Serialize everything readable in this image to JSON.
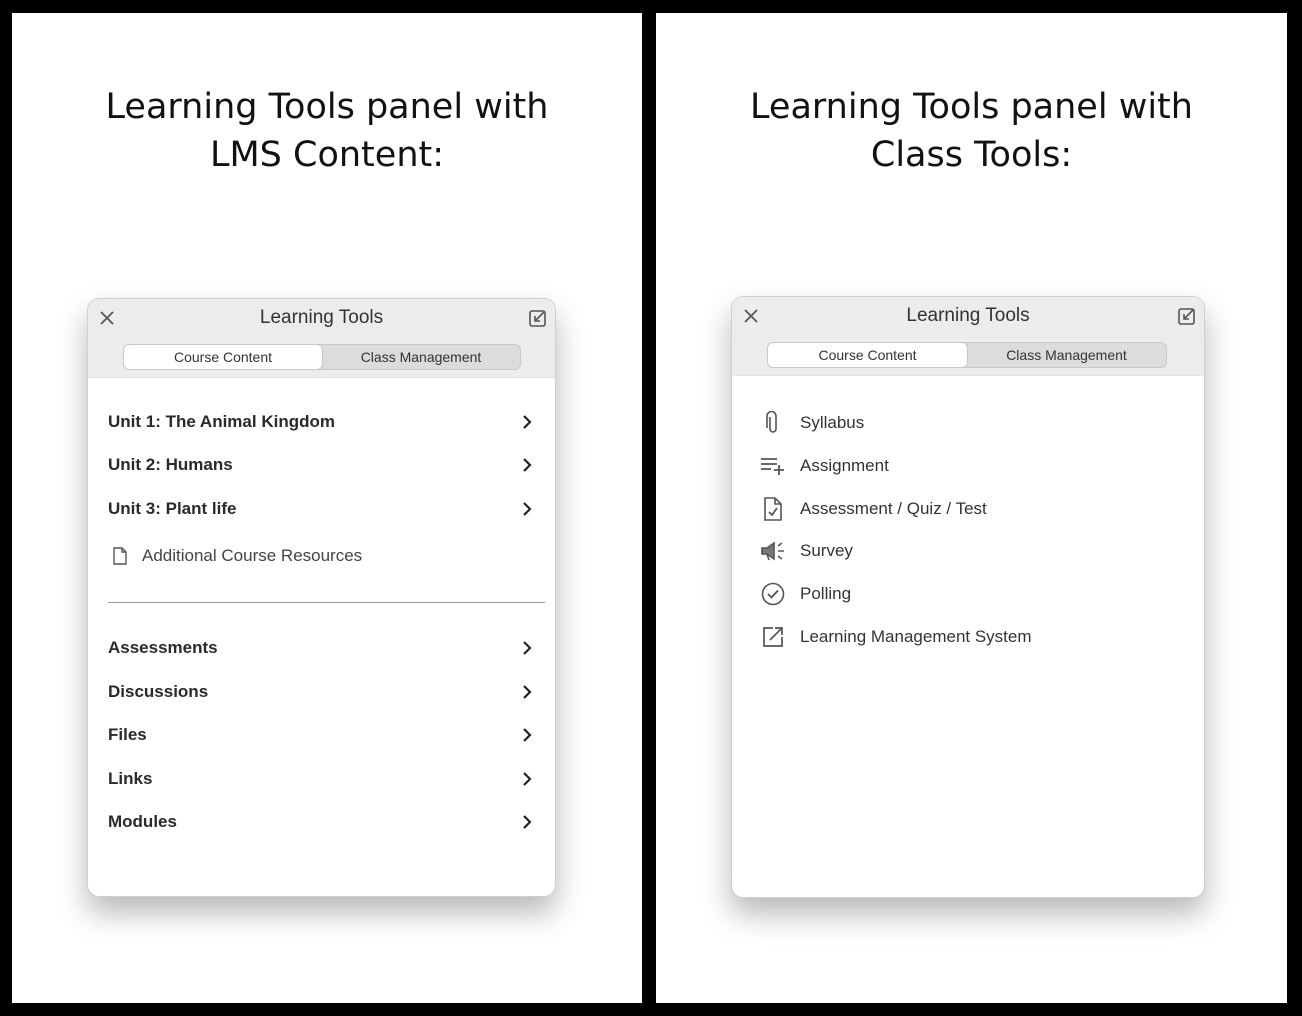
{
  "left": {
    "heading_line1": "Learning Tools panel with",
    "heading_line2": "LMS Content:",
    "panel": {
      "title": "Learning Tools",
      "tabs": [
        {
          "label": "Course Content",
          "active": true
        },
        {
          "label": "Class Management",
          "active": false
        }
      ],
      "units": [
        {
          "label": "Unit 1: The Animal Kingdom"
        },
        {
          "label": "Unit 2: Humans"
        },
        {
          "label": "Unit 3: Plant life"
        }
      ],
      "resource": {
        "label": "Additional Course Resources",
        "icon": "document-icon"
      },
      "sections": [
        {
          "label": "Assessments"
        },
        {
          "label": "Discussions"
        },
        {
          "label": "Files"
        },
        {
          "label": "Links"
        },
        {
          "label": "Modules"
        }
      ]
    }
  },
  "right": {
    "heading_line1": "Learning Tools panel with",
    "heading_line2": "Class Tools:",
    "panel": {
      "title": "Learning Tools",
      "tabs": [
        {
          "label": "Course Content",
          "active": true
        },
        {
          "label": "Class Management",
          "active": false
        }
      ],
      "tools": [
        {
          "label": "Syllabus",
          "icon": "paperclip-icon"
        },
        {
          "label": "Assignment",
          "icon": "playlist-add-icon"
        },
        {
          "label": "Assessment / Quiz / Test",
          "icon": "document-check-icon"
        },
        {
          "label": "Survey",
          "icon": "megaphone-icon"
        },
        {
          "label": "Polling",
          "icon": "check-circle-icon"
        },
        {
          "label": "Learning Management System",
          "icon": "external-link-icon"
        }
      ]
    }
  }
}
